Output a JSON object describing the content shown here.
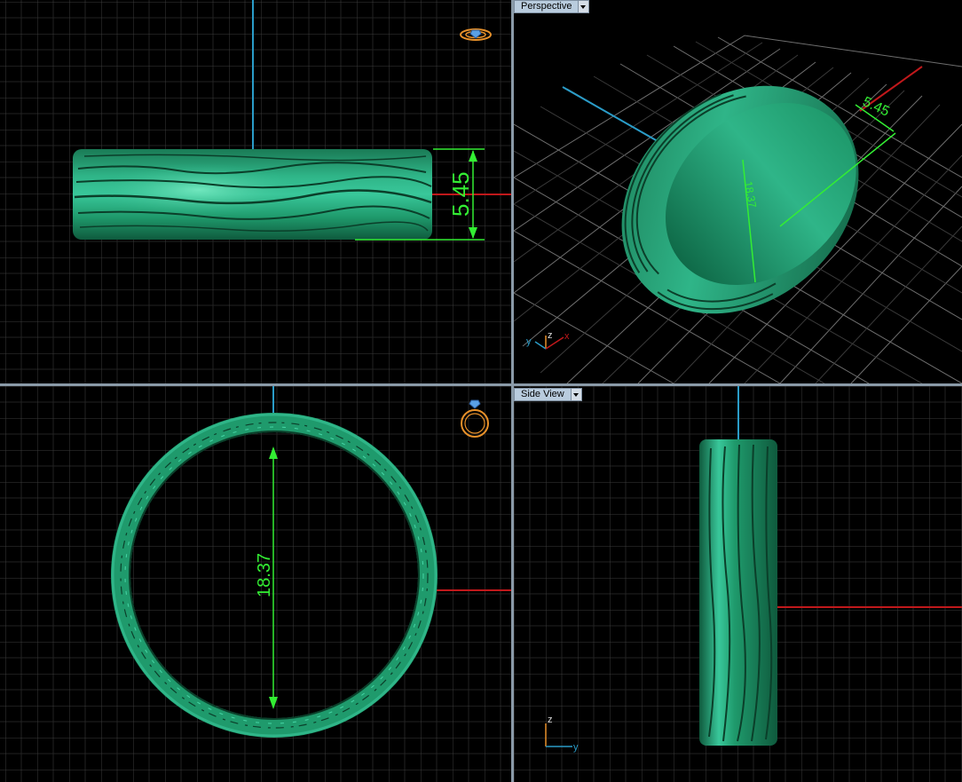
{
  "viewports": {
    "top": {
      "dimension_label": "5.45"
    },
    "perspective": {
      "label": "Perspective",
      "dimension_width": "5.45",
      "dimension_diameter": "18.37"
    },
    "front": {
      "dimension_label": "18.37"
    },
    "side": {
      "label": "Side View"
    }
  },
  "axis_labels": {
    "x": "x",
    "y": "y",
    "z": "z"
  },
  "colors": {
    "grid": "#3c3c3c",
    "grid_major": "#5f5f5f",
    "ring": "#1f9a6c",
    "dimension": "#33ee33",
    "axis_x": "#c0181b",
    "axis_y": "#2a9cc8"
  },
  "icons": [
    "ring-orientation-icon",
    "ring-front-icon",
    "dropdown-arrow-icon"
  ]
}
